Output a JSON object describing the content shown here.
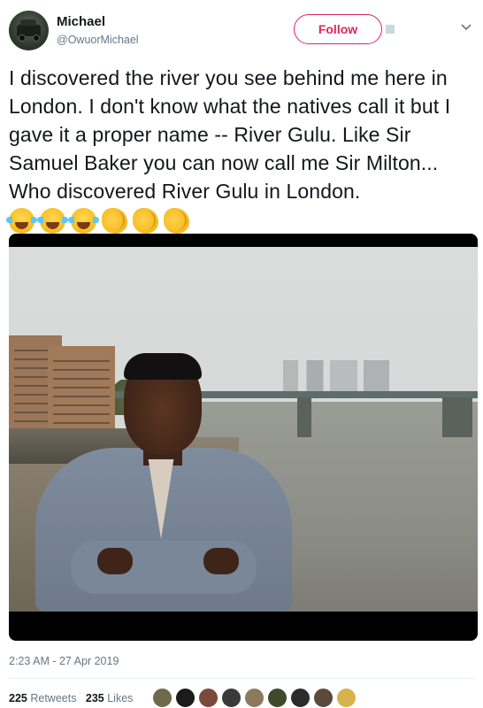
{
  "user": {
    "name": "Michael",
    "handle": "@OwuorMichael"
  },
  "follow_label": "Follow",
  "tweet": {
    "text": "I discovered the river you see behind me here in London. I don't know what the natives call it but I gave it a proper name -- River Gulu. Like Sir Samuel Baker you can now call me Sir Milton... Who discovered River Gulu in London.",
    "emojis": [
      "face-with-tears-of-joy",
      "face-with-tears-of-joy",
      "face-with-tears-of-joy",
      "clapping-hands",
      "clapping-hands",
      "clapping-hands"
    ]
  },
  "timestamp": "2:23 AM - 27 Apr 2019",
  "stats": {
    "retweets_count": "225",
    "retweets_label": "Retweets",
    "likes_count": "235",
    "likes_label": "Likes"
  },
  "likers": [
    "#6d6a4d",
    "#1b1b1b",
    "#7a4a3a",
    "#3a3a3a",
    "#8d7a5d",
    "#3f4a2a",
    "#2c2c2c",
    "#5b4a3a",
    "#d8b24a"
  ],
  "colors": {
    "accent": "#e0245e",
    "muted": "#657786",
    "text": "#14171a"
  }
}
